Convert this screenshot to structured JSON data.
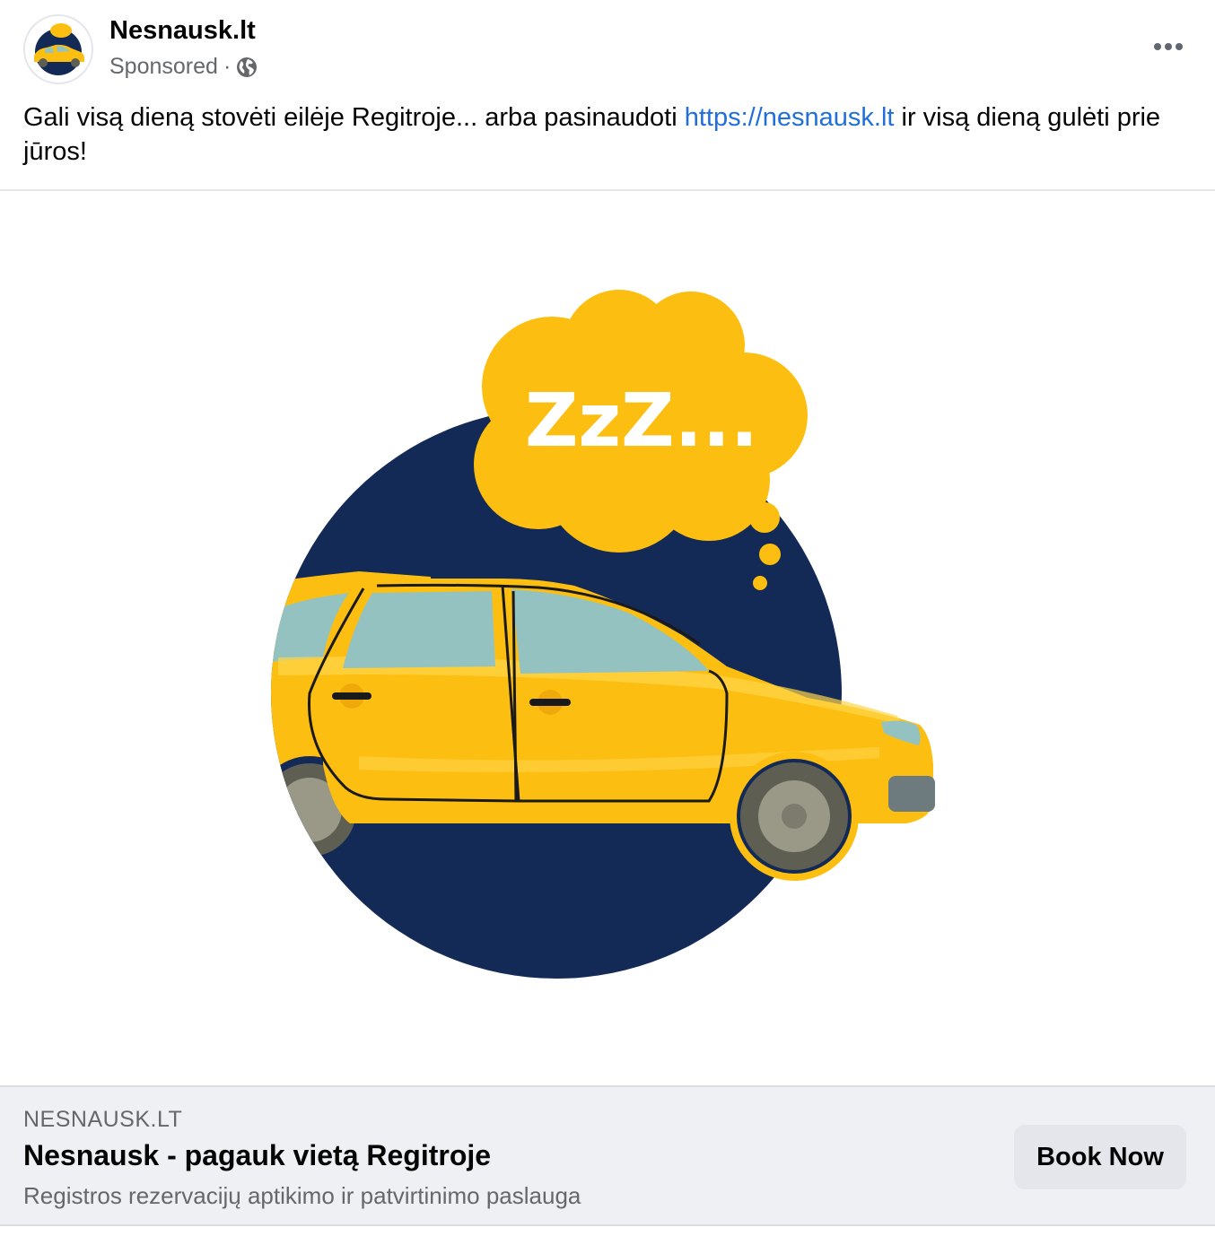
{
  "post": {
    "page_name": "Nesnausk.lt",
    "sponsored_label": "Sponsored",
    "separator": "·",
    "text_before_link": "Gali visą dieną stovėti eilėje Regitroje... arba pasinaudoti ",
    "link_text": "https://nesnausk.lt",
    "text_after_link": " ir visą dieną gulėti prie jūros!"
  },
  "image": {
    "bubble_text": "ZzZ..."
  },
  "link_preview": {
    "domain": "NESNAUSK.LT",
    "headline": "Nesnausk - pagauk vietą Regitroje",
    "description": "Registros rezervacijų aptikimo ir patvirtinimo paslauga",
    "cta_label": "Book Now"
  },
  "icons": {
    "privacy": "globe-icon",
    "menu": "more-options-icon"
  },
  "colors": {
    "link": "#216fdb",
    "navy": "#132a57",
    "yellow": "#fcbf11",
    "glass": "#94c2c0",
    "footer_bg": "#eef0f3"
  }
}
